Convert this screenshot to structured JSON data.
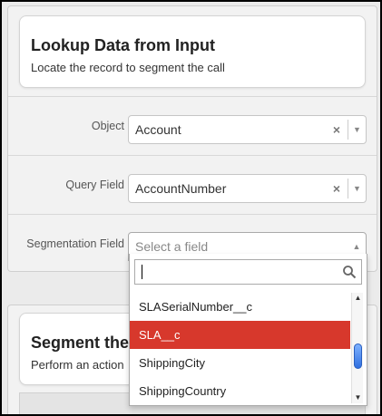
{
  "lookup": {
    "title": "Lookup Data from Input",
    "subtitle": "Locate the record to segment the call"
  },
  "fields": {
    "object": {
      "label": "Object",
      "value": "Account",
      "clear": "×"
    },
    "query_field": {
      "label": "Query Field",
      "value": "AccountNumber",
      "clear": "×"
    },
    "segmentation_field": {
      "label": "Segmentation Field",
      "placeholder": "Select a field"
    }
  },
  "dropdown": {
    "search_value": "",
    "options": [
      "SLASerialNumber__c",
      "SLA__c",
      "ShippingCity",
      "ShippingCountry"
    ],
    "highlighted_index": 1
  },
  "segment": {
    "title": "Segment the",
    "subtitle": "Perform an action"
  },
  "colors": {
    "highlight": "#d7382c",
    "scroll_thumb": "#2f6fe0"
  }
}
